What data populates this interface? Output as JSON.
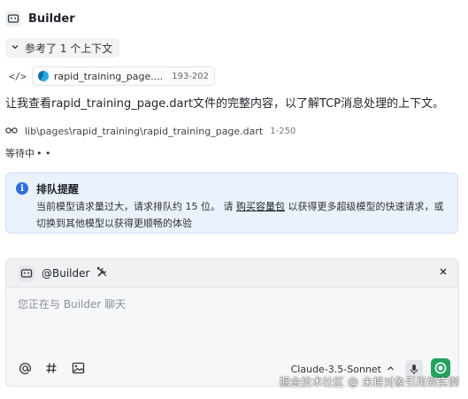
{
  "header": {
    "title": "Builder",
    "icon": "bot-icon"
  },
  "context": {
    "toggle_label": "参考了 1 个上下文",
    "chevron": "chevron-down-icon"
  },
  "file_chip": {
    "code_glyph": "</>",
    "filename": "rapid_training_page....",
    "range": "193-202"
  },
  "message": {
    "text": "让我查看rapid_training_page.dart文件的完整内容，以了解TCP消息处理的上下文。"
  },
  "read_file": {
    "path": "lib\\pages\\rapid_training\\rapid_training_page.dart",
    "range": "1-250"
  },
  "status": {
    "waiting_text": "等待中",
    "dots": "• •"
  },
  "alert": {
    "title": "排队提醒",
    "body_before": "当前模型请求量过大，请求排队约 15 位。 请 ",
    "link_text": "购买容量包",
    "body_after": " 以获得更多超级模型的快速请求，或切换到其他模型以获得更顺畅的体验",
    "accent": "#2f6fde",
    "background": "#eaf2fd"
  },
  "chat": {
    "mention": "@Builder",
    "placeholder": "您正在与 Builder 聊天",
    "model": "Claude-3.5-Sonnet",
    "send_color": "#23a35f"
  },
  "watermark": {
    "text": "掘金技术社区 @ 未将对象引用到实例"
  }
}
